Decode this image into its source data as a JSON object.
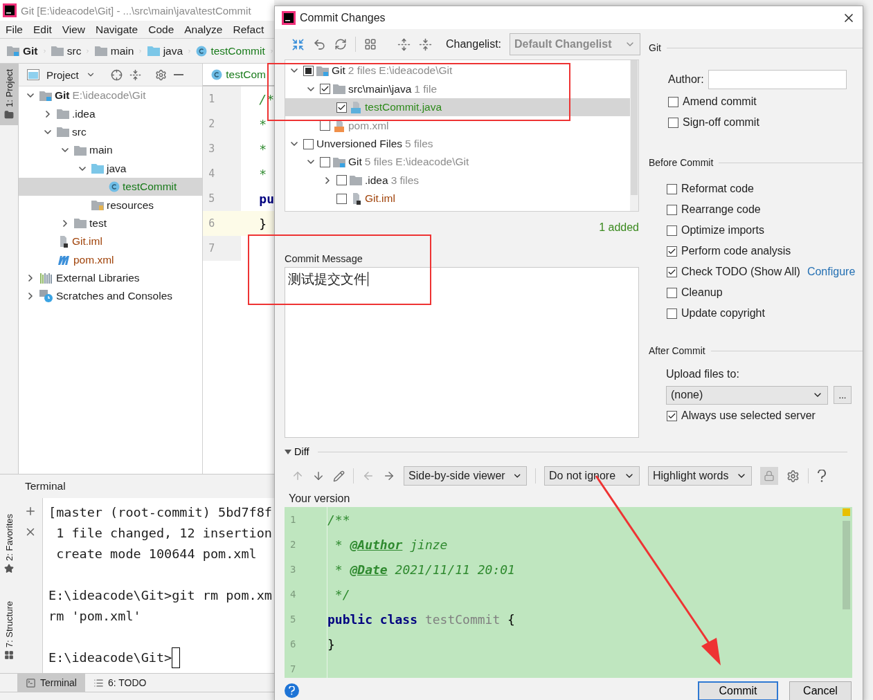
{
  "ide": {
    "title": "Git [E:\\ideacode\\Git] - ...\\src\\main\\java\\testCommit",
    "menu": [
      "File",
      "Edit",
      "View",
      "Navigate",
      "Code",
      "Analyze",
      "Refact"
    ],
    "breadcrumbs": [
      {
        "label": "Git",
        "kind": "project"
      },
      {
        "label": "src",
        "kind": "folder"
      },
      {
        "label": "main",
        "kind": "folder"
      },
      {
        "label": "java",
        "kind": "source"
      },
      {
        "label": "testCommit",
        "kind": "class"
      }
    ],
    "tool_stripe": [
      {
        "label": "1: Project",
        "kind": "folder",
        "selected": true
      },
      {
        "label": "2: Favorites",
        "kind": "star",
        "selected": false
      },
      {
        "label": "7: Structure",
        "kind": "structure",
        "selected": false
      }
    ],
    "project_panel": {
      "title": "Project",
      "tree": [
        {
          "label": "Git",
          "detail": "E:\\ideacode\\Git",
          "kind": "project",
          "expanded": true,
          "selected": false,
          "children": [
            {
              "label": ".idea",
              "kind": "folder",
              "expanded": false,
              "selected": false
            },
            {
              "label": "src",
              "kind": "folder",
              "expanded": true,
              "selected": false,
              "children": [
                {
                  "label": "main",
                  "kind": "folder",
                  "expanded": true,
                  "selected": false,
                  "children": [
                    {
                      "label": "java",
                      "kind": "source",
                      "expanded": true,
                      "selected": false,
                      "children": [
                        {
                          "label": "testCommit",
                          "kind": "class",
                          "selected": true
                        }
                      ]
                    },
                    {
                      "label": "resources",
                      "kind": "resources",
                      "selected": false
                    }
                  ]
                },
                {
                  "label": "test",
                  "kind": "folder",
                  "expanded": false,
                  "selected": false
                }
              ]
            },
            {
              "label": "Git.iml",
              "kind": "iml",
              "selected": false
            },
            {
              "label": "pom.xml",
              "kind": "maven",
              "selected": false
            }
          ]
        },
        {
          "label": "External Libraries",
          "kind": "libraries",
          "expanded": false,
          "selected": false
        },
        {
          "label": "Scratches and Consoles",
          "kind": "scratches",
          "expanded": false,
          "selected": false
        }
      ]
    },
    "editor": {
      "tab": "testCom",
      "lines": [
        {
          "number": "1",
          "text": "/*",
          "kind": "comment",
          "current": false
        },
        {
          "number": "2",
          "text": "*",
          "kind": "comment",
          "current": false
        },
        {
          "number": "3",
          "text": "*",
          "kind": "comment",
          "current": false
        },
        {
          "number": "4",
          "text": "*",
          "kind": "comment",
          "current": false
        },
        {
          "number": "5",
          "text": "pu",
          "kind": "keyword",
          "current": false
        },
        {
          "number": "6",
          "text": "}",
          "kind": "plain",
          "current": true
        },
        {
          "number": "7",
          "current": false
        }
      ]
    },
    "terminal": {
      "title": "Terminal",
      "blocks": [
        [
          "[master (root-commit) 5bd7f8f",
          " 1 file changed, 12 insertion",
          " create mode 100644 pom.xml"
        ],
        [
          "E:\\ideacode\\Git>git rm pom.xm",
          "rm 'pom.xml'"
        ]
      ],
      "prompt": "E:\\ideacode\\Git>"
    },
    "bottom_tabs": [
      {
        "label": "Terminal",
        "kind": "terminal",
        "selected": true
      },
      {
        "label": "6: TODO",
        "kind": "todo",
        "selected": false
      }
    ]
  },
  "dialog": {
    "title": "Commit Changes",
    "changelist": {
      "label": "Changelist:",
      "value": "Default Changelist"
    },
    "changes": [
      {
        "label": "Git",
        "count": "2 files",
        "path": "E:\\ideacode\\Git",
        "kind": "project",
        "partial": true,
        "color": "#1e1e1e",
        "expanded": true,
        "selected": false,
        "children": [
          {
            "label": "src\\main\\java",
            "count": "1 file",
            "kind": "folder",
            "checked": true,
            "color": "#1e1e1e",
            "expanded": true,
            "selected": false,
            "children": [
              {
                "label": "testCommit.java",
                "kind": "java",
                "checked": true,
                "color": "#2d8a1a",
                "selected": true
              }
            ]
          },
          {
            "label": "pom.xml",
            "kind": "xml",
            "checked": false,
            "color": "#8c8c8c",
            "selected": false
          }
        ]
      },
      {
        "label": "Unversioned Files",
        "count": "5 files",
        "kind": "none",
        "checked": false,
        "color": "#1e1e1e",
        "expanded": true,
        "selected": false,
        "children": [
          {
            "label": "Git",
            "count": "5 files",
            "path": "E:\\ideacode\\Git",
            "kind": "project",
            "checked": false,
            "color": "#1e1e1e",
            "expanded": true,
            "selected": false,
            "children": [
              {
                "label": ".idea",
                "count": "3 files",
                "kind": "folder",
                "checked": false,
                "color": "#1e1e1e",
                "expanded": false,
                "selected": false
              },
              {
                "label": "Git.iml",
                "kind": "iml",
                "checked": false,
                "color": "#a0430a",
                "selected": false
              }
            ]
          }
        ]
      }
    ],
    "summary": "1 added",
    "commit_message": {
      "label": "Commit Message",
      "value": "测试提交文件"
    },
    "git": {
      "title": "Git",
      "author": {
        "label": "Author:"
      },
      "options": [
        {
          "label": "Amend commit",
          "checked": false
        },
        {
          "label": "Sign-off commit",
          "checked": false
        }
      ]
    },
    "before_commit": {
      "title": "Before Commit",
      "options": [
        {
          "label": "Reformat code",
          "checked": false
        },
        {
          "label": "Rearrange code",
          "checked": false
        },
        {
          "label": "Optimize imports",
          "checked": false
        },
        {
          "label": "Perform code analysis",
          "checked": true
        },
        {
          "label": "Check TODO (Show All)",
          "checked": true,
          "link": "Configure"
        },
        {
          "label": "Cleanup",
          "checked": false
        },
        {
          "label": "Update copyright",
          "checked": false
        }
      ]
    },
    "after_commit": {
      "title": "After Commit",
      "upload_label": "Upload files to:",
      "upload_value": "(none)",
      "browse": "...",
      "options": [
        {
          "label": "Always use selected server",
          "checked": true
        }
      ]
    },
    "diff": {
      "title": "Diff",
      "expanded": true,
      "viewer": "Side-by-side viewer",
      "ignore": "Do not ignore",
      "highlight": "Highlight words",
      "version_label": "Your version",
      "lines": [
        {
          "number": "1",
          "tokens": [
            {
              "text": "/**",
              "kind": "comment"
            }
          ]
        },
        {
          "number": "2",
          "tokens": [
            {
              "text": " * ",
              "kind": "comment"
            },
            {
              "text": "@Author",
              "kind": "tag"
            },
            {
              "text": " jinze",
              "kind": "comment"
            }
          ]
        },
        {
          "number": "3",
          "tokens": [
            {
              "text": " * ",
              "kind": "comment"
            },
            {
              "text": "@Date",
              "kind": "tag"
            },
            {
              "text": " 2021/11/11 20:01",
              "kind": "comment"
            }
          ]
        },
        {
          "number": "4",
          "tokens": [
            {
              "text": " */",
              "kind": "comment"
            }
          ]
        },
        {
          "number": "5",
          "tokens": [
            {
              "text": "public class ",
              "kind": "keyword"
            },
            {
              "text": "testCommit",
              "kind": "unused"
            },
            {
              "text": " {",
              "kind": "plain"
            }
          ]
        },
        {
          "number": "6",
          "tokens": [
            {
              "text": "}",
              "kind": "plain"
            }
          ]
        },
        {
          "number": "7"
        }
      ]
    },
    "buttons": [
      {
        "label": "Commit",
        "kind": "default"
      },
      {
        "label": "Cancel",
        "kind": "normal"
      }
    ]
  }
}
